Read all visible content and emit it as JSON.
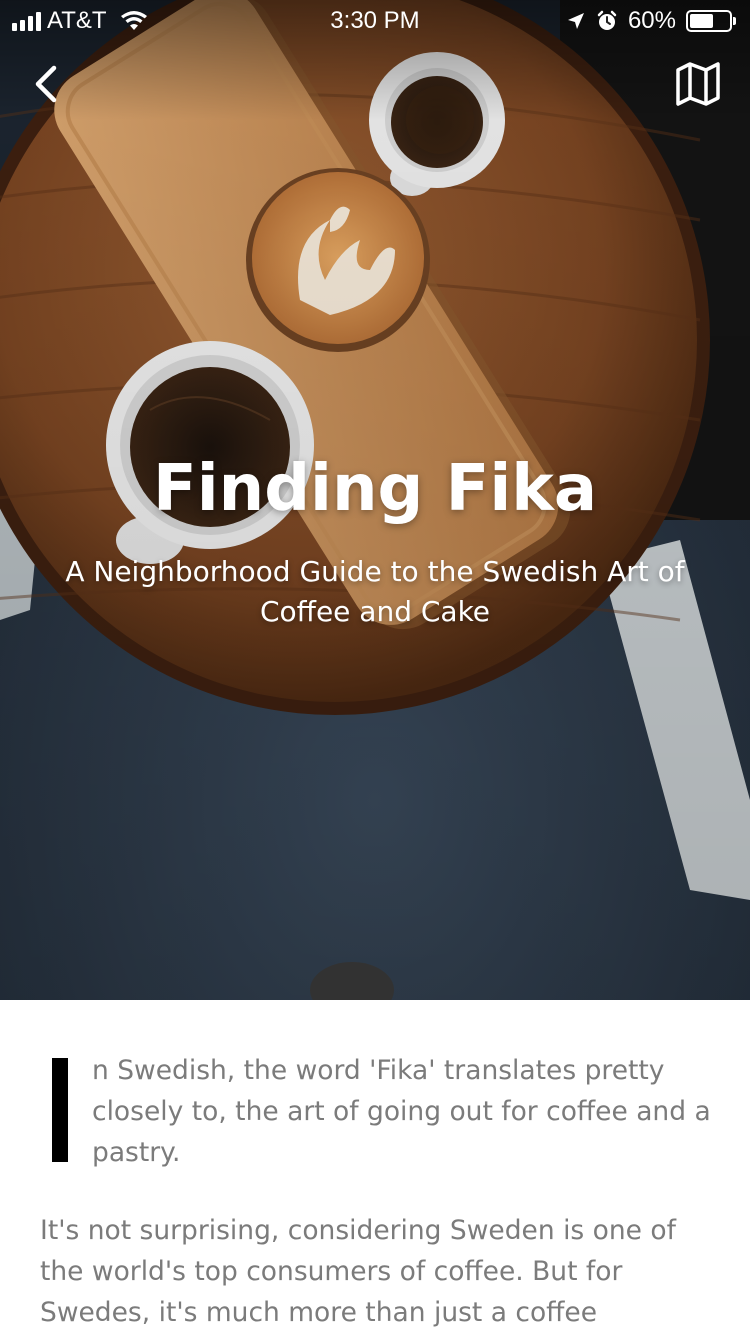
{
  "status_bar": {
    "carrier": "AT&T",
    "time": "3:30 PM",
    "battery_percent": "60%",
    "battery_level": 0.6,
    "icons": [
      "signal-icon",
      "wifi-icon",
      "location-arrow-icon",
      "alarm-icon",
      "battery-icon"
    ]
  },
  "nav": {
    "back_icon": "chevron-left-icon",
    "map_icon": "map-icon"
  },
  "hero": {
    "title": "Finding Fika",
    "subtitle": "A Neighborhood Guide to the Swedish Art of Coffee and Cake"
  },
  "article": {
    "lead_text": "n Swedish, the word 'Fika' translates pretty closely to, the art of going out for coffee and a pastry.",
    "paragraph_1": "It's not surprising, considering Sweden is one of the world's top consumers of coffee. But for Swedes, it's much more than just a coffee"
  },
  "colors": {
    "body_text": "#7b7b7b",
    "drop_cap": "#000000",
    "hero_overlay_text": "#ffffff"
  }
}
